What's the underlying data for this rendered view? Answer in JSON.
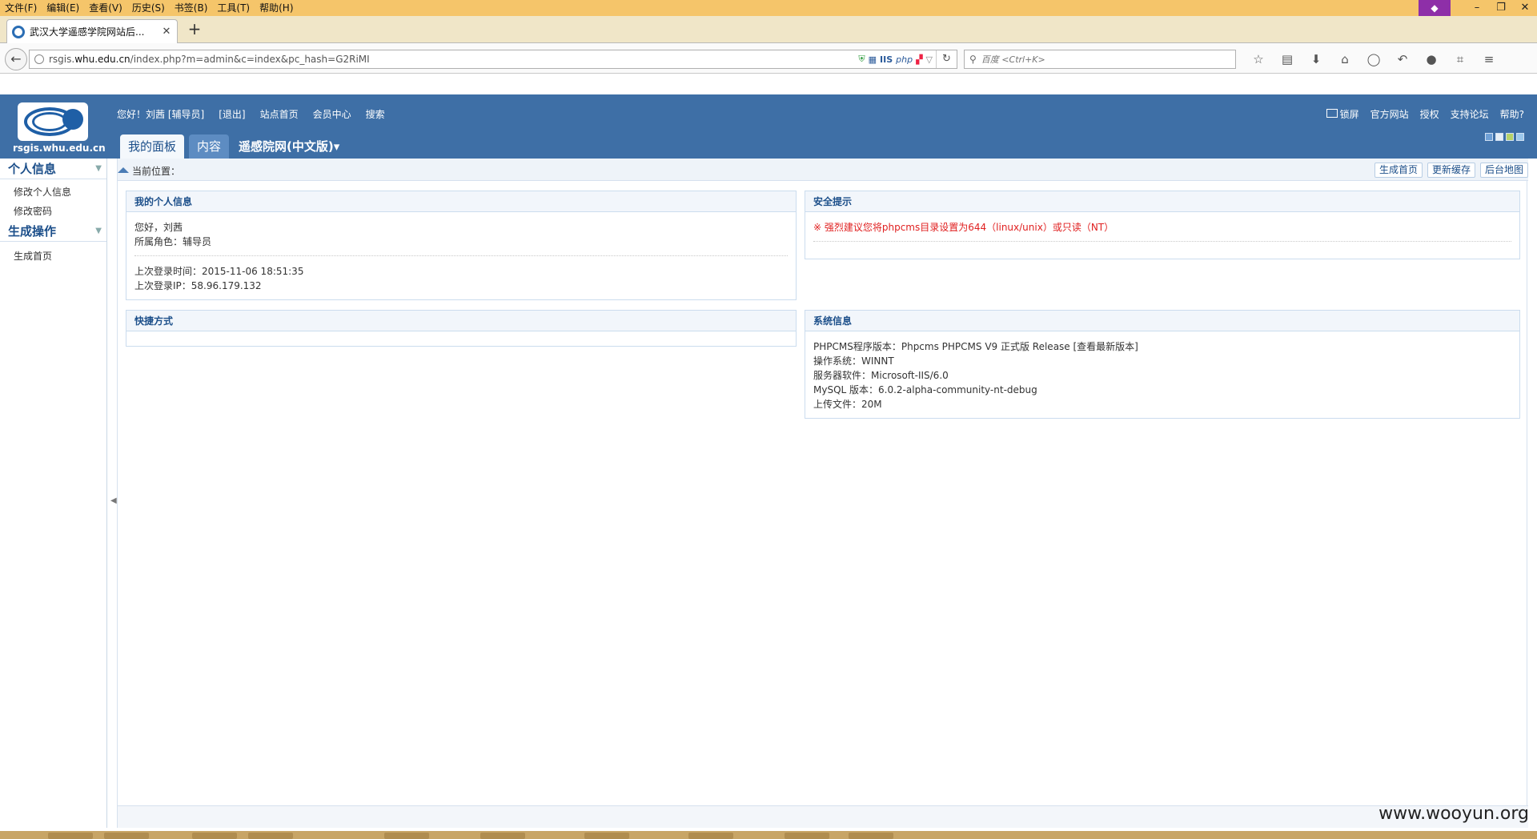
{
  "browser": {
    "menu": [
      "文件(F)",
      "编辑(E)",
      "查看(V)",
      "历史(S)",
      "书签(B)",
      "工具(T)",
      "帮助(H)"
    ],
    "tab_title": "武汉大学遥感学院网站后...",
    "url_prefix": "rsgis.",
    "url_domain": "whu.edu.cn",
    "url_path": "/index.php?m=admin&c=index&pc_hash=G2RiMI",
    "addon_labels": [
      "IIS",
      "php"
    ],
    "search_placeholder": "百度 <Ctrl+K>"
  },
  "header": {
    "logo_text": "rsgis.whu.edu.cn",
    "top_links": [
      "您好！刘茜 [辅导员]",
      "[退出]",
      "站点首页",
      "会员中心",
      "搜索"
    ],
    "right_links": [
      "锁屏",
      "官方网站",
      "授权",
      "支持论坛",
      "帮助?"
    ],
    "tabs": [
      "我的面板",
      "内容"
    ],
    "site_select": "遥感院网(中文版)"
  },
  "sidebar": {
    "groups": [
      {
        "title": "个人信息",
        "items": [
          "修改个人信息",
          "修改密码"
        ]
      },
      {
        "title": "生成操作",
        "items": [
          "生成首页"
        ]
      }
    ]
  },
  "main": {
    "crumb_label": "当前位置：",
    "crumb_buttons": [
      "生成首页",
      "更新缓存",
      "后台地图"
    ],
    "profile": {
      "title": "我的个人信息",
      "greeting": "您好，刘茜",
      "role": "所属角色：辅导员",
      "last_login_time": "上次登录时间：2015-11-06 18:51:35",
      "last_login_ip": "上次登录IP：58.96.179.132"
    },
    "security": {
      "title": "安全提示",
      "warning": "※ 强烈建议您将phpcms目录设置为644（linux/unix）或只读（NT）"
    },
    "shortcuts": {
      "title": "快捷方式"
    },
    "sysinfo": {
      "title": "系统信息",
      "lines": [
        "PHPCMS程序版本：Phpcms PHPCMS V9 正式版 Release [查看最新版本]",
        "操作系统：WINNT",
        "服务器软件：Microsoft-IIS/6.0",
        "MySQL 版本：6.0.2-alpha-community-nt-debug",
        "上传文件：20M"
      ]
    }
  },
  "watermark": "www.wooyun.org"
}
